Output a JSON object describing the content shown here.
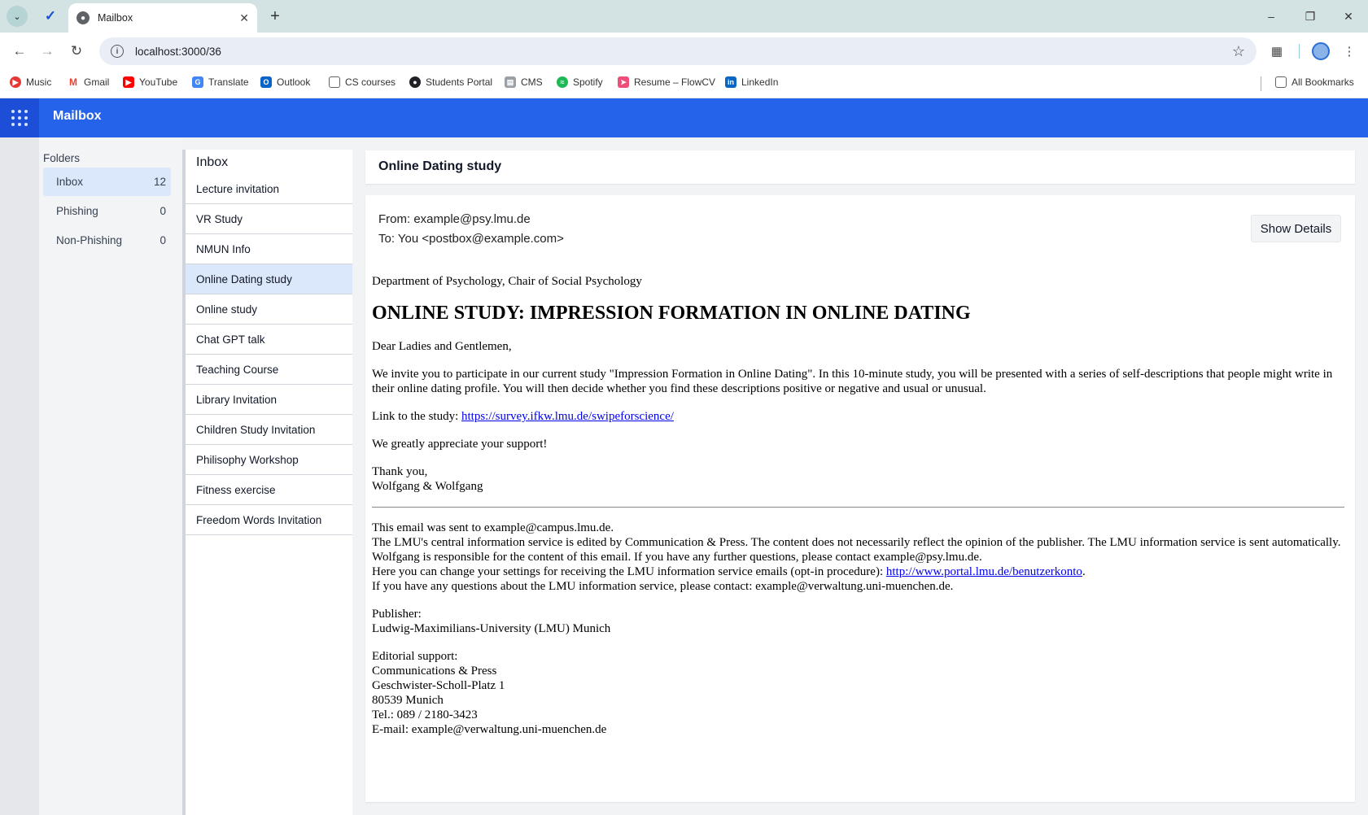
{
  "browser": {
    "tab_title": "Mailbox",
    "url": "localhost:3000/36",
    "bookmarks": [
      {
        "label": "Music",
        "color": "#e53935"
      },
      {
        "label": "Gmail",
        "color": "#ea4335"
      },
      {
        "label": "YouTube",
        "color": "#ff0000"
      },
      {
        "label": "Translate",
        "color": "#4285f4"
      },
      {
        "label": "Outlook",
        "color": "#0a64c8"
      },
      {
        "label": "CS courses",
        "color": "#5f6368"
      },
      {
        "label": "Students Portal",
        "color": "#202124"
      },
      {
        "label": "CMS",
        "color": "#9aa0a6"
      },
      {
        "label": "Spotify",
        "color": "#1db954"
      },
      {
        "label": "Resume – FlowCV",
        "color": "#ef4d7a"
      },
      {
        "label": "LinkedIn",
        "color": "#0a66c2"
      }
    ],
    "all_bookmarks": "All Bookmarks"
  },
  "app": {
    "title": "Mailbox",
    "accent": "#2563eb"
  },
  "folders": {
    "title": "Folders",
    "items": [
      {
        "label": "Inbox",
        "count": "12"
      },
      {
        "label": "Phishing",
        "count": "0"
      },
      {
        "label": "Non-Phishing",
        "count": "0"
      }
    ]
  },
  "inbox": {
    "title": "Inbox",
    "items": [
      "Lecture invitation",
      "VR Study",
      "NMUN Info",
      "Online Dating study",
      "Online study",
      "Chat GPT talk",
      "Teaching Course",
      "Library Invitation",
      "Children Study Invitation",
      "Philisophy Workshop",
      "Fitness exercise",
      "Freedom Words Invitation"
    ]
  },
  "email": {
    "subject": "Online Dating study",
    "from": "From: example@psy.lmu.de",
    "to": "To: You <postbox@example.com>",
    "details_button": "Show Details",
    "dept": "Department of Psychology, Chair of Social Psychology",
    "heading": "ONLINE STUDY: IMPRESSION FORMATION IN ONLINE DATING",
    "greeting": "Dear Ladies and Gentlemen,",
    "invite": "We invite you to participate in our current study \"Impression Formation in Online Dating\". In this 10-minute study, you will be presented with a series of self-descriptions that people might write in their online dating profile. You will then decide whether you find these descriptions positive or negative and usual or unusual.",
    "link_prefix": "Link to the study: ",
    "link": "https://survey.ifkw.lmu.de/swipeforscience/",
    "appreciate": "We greatly appreciate your support!",
    "thanks": "Thank you,",
    "signature": "Wolfgang & Wolfgang",
    "footer_sent": "This email was sent to example@campus.lmu.de.",
    "footer_central": "The LMU's central information service is edited by Communication & Press. The content does not necessarily reflect the opinion of the publisher. The LMU information service is sent automatically.",
    "footer_responsible": "Wolfgang is responsible for the content of this email. If you have any further questions, please contact example@psy.lmu.de.",
    "footer_settings_prefix": "Here you can change your settings for receiving the LMU information service emails (opt-in procedure): ",
    "footer_settings_link": "http://www.portal.lmu.de/benutzerkonto",
    "footer_settings_suffix": ".",
    "footer_questions": "If you have any questions about the LMU information service, please contact: example@verwaltung.uni-muenchen.de.",
    "publisher_label": "Publisher:",
    "publisher_name": "Ludwig-Maximilians-University (LMU) Munich",
    "editorial_label": "Editorial support:",
    "editorial_org": "Communications & Press",
    "editorial_street": "Geschwister-Scholl-Platz 1",
    "editorial_city": "80539 Munich",
    "editorial_tel": "Tel.: 089 / 2180-3423",
    "editorial_email": "E-mail: example@verwaltung.uni-muenchen.de"
  }
}
